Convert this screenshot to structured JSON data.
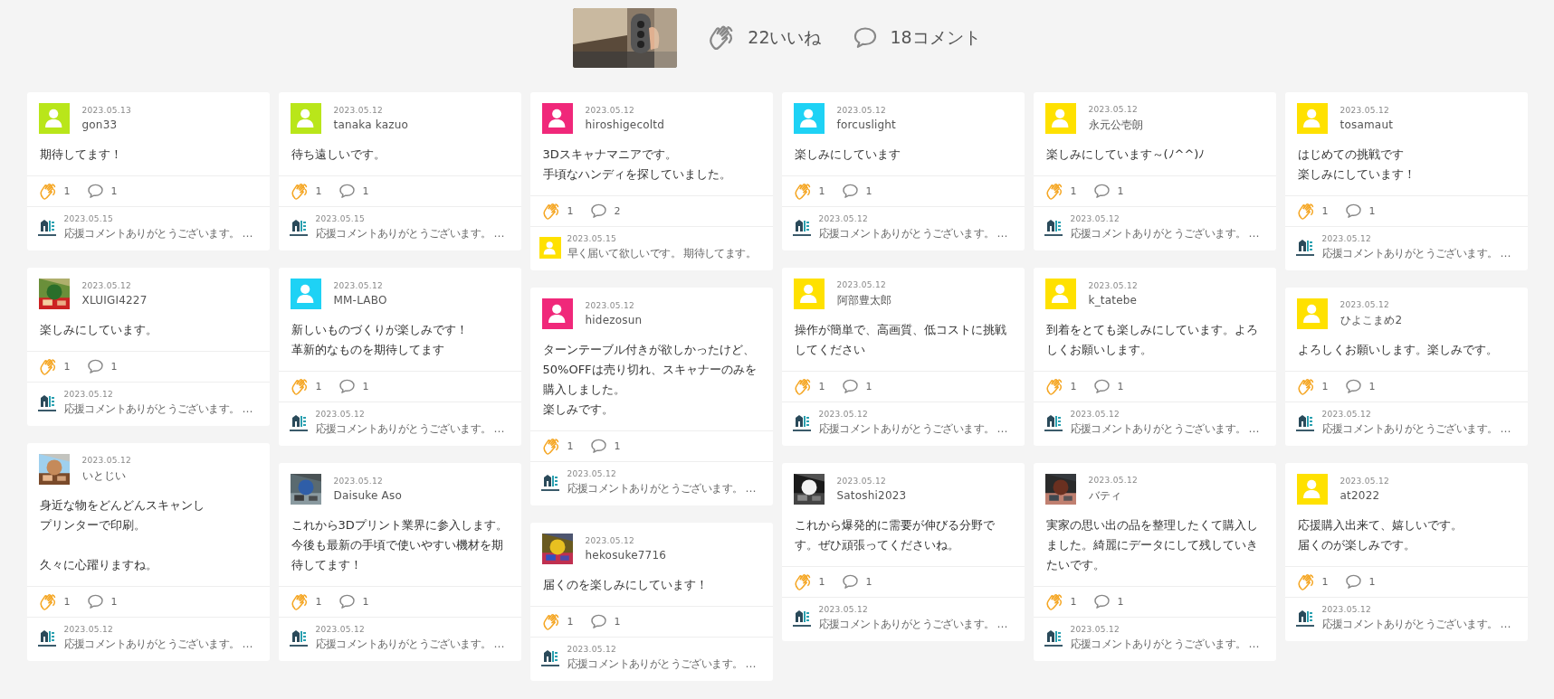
{
  "header": {
    "thumbnail": {
      "kind": "picture"
    },
    "likes": "22いいね",
    "comments": "18コメント"
  },
  "columns": [
    [
      {
        "date": "2023.05.13",
        "user": "gon33",
        "avatar": {
          "kind": "default",
          "color": "#b9e61a"
        },
        "paragraphs": [
          [
            "期待してます！"
          ]
        ],
        "likes": "1",
        "comments": "1",
        "reply": {
          "avatar": {
            "kind": "logo"
          },
          "date": "2023.05.15",
          "text": "応援コメントありがとうございます。 …"
        }
      },
      {
        "date": "2023.05.12",
        "user": "XLUIGI4227",
        "avatar": {
          "kind": "picture"
        },
        "paragraphs": [
          [
            "楽しみにしています。"
          ]
        ],
        "likes": "1",
        "comments": "1",
        "reply": {
          "avatar": {
            "kind": "logo"
          },
          "date": "2023.05.12",
          "text": "応援コメントありがとうございます。 …"
        }
      },
      {
        "date": "2023.05.12",
        "user": "いとじい",
        "avatar": {
          "kind": "picture"
        },
        "paragraphs": [
          [
            "身近な物をどんどんスキャンし",
            "プリンターで印刷。"
          ],
          [
            "久々に心躍りますね。"
          ]
        ],
        "likes": "1",
        "comments": "1",
        "reply": {
          "avatar": {
            "kind": "logo"
          },
          "date": "2023.05.12",
          "text": "応援コメントありがとうございます。 …"
        }
      }
    ],
    [
      {
        "date": "2023.05.12",
        "user": "tanaka kazuo",
        "avatar": {
          "kind": "default",
          "color": "#b9e61a"
        },
        "paragraphs": [
          [
            "待ち遠しいです。"
          ]
        ],
        "likes": "1",
        "comments": "1",
        "reply": {
          "avatar": {
            "kind": "logo"
          },
          "date": "2023.05.15",
          "text": "応援コメントありがとうございます。 …"
        }
      },
      {
        "date": "2023.05.12",
        "user": "MM-LABO",
        "avatar": {
          "kind": "default",
          "color": "#1ed2f5"
        },
        "paragraphs": [
          [
            "新しいものづくりが楽しみです！",
            "革新的なものを期待してます"
          ]
        ],
        "likes": "1",
        "comments": "1",
        "reply": {
          "avatar": {
            "kind": "logo"
          },
          "date": "2023.05.12",
          "text": "応援コメントありがとうございます。 …"
        }
      },
      {
        "date": "2023.05.12",
        "user": "Daisuke Aso",
        "avatar": {
          "kind": "picture"
        },
        "paragraphs": [
          [
            "これから3Dプリント業界に参入します。",
            "今後も最新の手頃で使いやすい機材を期待してます！"
          ]
        ],
        "likes": "1",
        "comments": "1",
        "reply": {
          "avatar": {
            "kind": "logo"
          },
          "date": "2023.05.12",
          "text": "応援コメントありがとうございます。 …"
        }
      }
    ],
    [
      {
        "date": "2023.05.12",
        "user": "hiroshigecoltd",
        "avatar": {
          "kind": "default",
          "color": "#f0287a"
        },
        "paragraphs": [
          [
            "3Dスキャナマニアです。",
            "手頃なハンディを探していました。"
          ]
        ],
        "likes": "1",
        "comments": "2",
        "reply": {
          "avatar": {
            "kind": "default",
            "color": "#ffe100"
          },
          "date": "2023.05.15",
          "text": "早く届いて欲しいです。 期待してます。"
        }
      },
      {
        "date": "2023.05.12",
        "user": "hidezosun",
        "avatar": {
          "kind": "default",
          "color": "#f0287a"
        },
        "paragraphs": [
          [
            "ターンテーブル付きが欲しかったけど、50%OFFは売り切れ、スキャナーのみを購入しました。",
            "楽しみです。"
          ]
        ],
        "likes": "1",
        "comments": "1",
        "reply": {
          "avatar": {
            "kind": "logo"
          },
          "date": "2023.05.12",
          "text": "応援コメントありがとうございます。 …"
        }
      },
      {
        "date": "2023.05.12",
        "user": "hekosuke7716",
        "avatar": {
          "kind": "picture"
        },
        "paragraphs": [
          [
            "届くのを楽しみにしています！"
          ]
        ],
        "likes": "1",
        "comments": "1",
        "reply": {
          "avatar": {
            "kind": "logo"
          },
          "date": "2023.05.12",
          "text": "応援コメントありがとうございます。 …"
        }
      }
    ],
    [
      {
        "date": "2023.05.12",
        "user": "forcuslight",
        "avatar": {
          "kind": "default",
          "color": "#1ed2f5"
        },
        "paragraphs": [
          [
            "楽しみにしています"
          ]
        ],
        "likes": "1",
        "comments": "1",
        "reply": {
          "avatar": {
            "kind": "logo"
          },
          "date": "2023.05.12",
          "text": "応援コメントありがとうございます。 …"
        }
      },
      {
        "date": "2023.05.12",
        "user": "阿部豊太郎",
        "avatar": {
          "kind": "default",
          "color": "#ffe100"
        },
        "paragraphs": [
          [
            "操作が簡単で、高画質、低コストに挑戦してください"
          ]
        ],
        "likes": "1",
        "comments": "1",
        "reply": {
          "avatar": {
            "kind": "logo"
          },
          "date": "2023.05.12",
          "text": "応援コメントありがとうございます。 …"
        }
      },
      {
        "date": "2023.05.12",
        "user": "Satoshi2023",
        "avatar": {
          "kind": "picture"
        },
        "paragraphs": [
          [
            "これから爆発的に需要が伸びる分野です。ぜひ頑張ってくださいね。"
          ]
        ],
        "likes": "1",
        "comments": "1",
        "reply": {
          "avatar": {
            "kind": "logo"
          },
          "date": "2023.05.12",
          "text": "応援コメントありがとうございます。 …"
        }
      }
    ],
    [
      {
        "date": "2023.05.12",
        "user": "永元公壱朗",
        "avatar": {
          "kind": "default",
          "color": "#ffe100"
        },
        "paragraphs": [
          [
            "楽しみにしています～(ﾉ^^)ﾉ"
          ]
        ],
        "likes": "1",
        "comments": "1",
        "reply": {
          "avatar": {
            "kind": "logo"
          },
          "date": "2023.05.12",
          "text": "応援コメントありがとうございます。 …"
        }
      },
      {
        "date": "2023.05.12",
        "user": "k_tatebe",
        "avatar": {
          "kind": "default",
          "color": "#ffe100"
        },
        "paragraphs": [
          [
            "到着をとても楽しみにしています。よろしくお願いします。"
          ]
        ],
        "likes": "1",
        "comments": "1",
        "reply": {
          "avatar": {
            "kind": "logo"
          },
          "date": "2023.05.12",
          "text": "応援コメントありがとうございます。 …"
        }
      },
      {
        "date": "2023.05.12",
        "user": "バティ",
        "avatar": {
          "kind": "picture"
        },
        "paragraphs": [
          [
            "実家の思い出の品を整理したくて購入しました。綺麗にデータにして残していきたいです。"
          ]
        ],
        "likes": "1",
        "comments": "1",
        "reply": {
          "avatar": {
            "kind": "logo"
          },
          "date": "2023.05.12",
          "text": "応援コメントありがとうございます。 …"
        }
      }
    ],
    [
      {
        "date": "2023.05.12",
        "user": "tosamaut",
        "avatar": {
          "kind": "default",
          "color": "#ffe100"
        },
        "paragraphs": [
          [
            "はじめての挑戦です",
            "楽しみにしています！"
          ]
        ],
        "likes": "1",
        "comments": "1",
        "reply": {
          "avatar": {
            "kind": "logo"
          },
          "date": "2023.05.12",
          "text": "応援コメントありがとうございます。 …"
        }
      },
      {
        "date": "2023.05.12",
        "user": "ひよこまめ2",
        "avatar": {
          "kind": "default",
          "color": "#ffe100"
        },
        "paragraphs": [
          [
            "よろしくお願いします。楽しみです。"
          ]
        ],
        "likes": "1",
        "comments": "1",
        "reply": {
          "avatar": {
            "kind": "logo"
          },
          "date": "2023.05.12",
          "text": "応援コメントありがとうございます。 …"
        }
      },
      {
        "date": "2023.05.12",
        "user": "at2022",
        "avatar": {
          "kind": "default",
          "color": "#ffe100"
        },
        "paragraphs": [
          [
            "応援購入出来て、嬉しいです。",
            "届くのが楽しみです。"
          ]
        ],
        "likes": "1",
        "comments": "1",
        "reply": {
          "avatar": {
            "kind": "logo"
          },
          "date": "2023.05.12",
          "text": "応援コメントありがとうございます。 …"
        }
      }
    ]
  ]
}
